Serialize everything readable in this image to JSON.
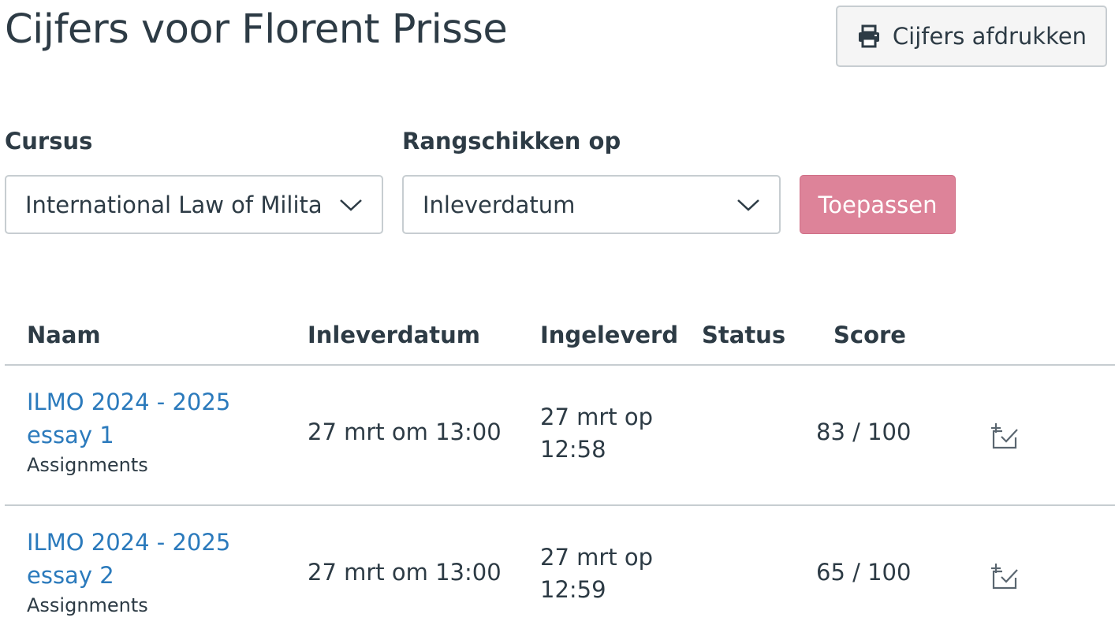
{
  "page": {
    "title": "Cijfers voor Florent Prisse"
  },
  "toolbar": {
    "print_label": "Cijfers afdrukken"
  },
  "filters": {
    "course_label": "Cursus",
    "course_value": "International Law of Militar",
    "sort_label": "Rangschikken op",
    "sort_value": "Inleverdatum",
    "apply_label": "Toepassen"
  },
  "table": {
    "headers": {
      "name": "Naam",
      "due": "Inleverdatum",
      "submitted": "Ingeleverd",
      "status": "Status",
      "score": "Score"
    },
    "rows": [
      {
        "name_line1": "ILMO 2024 - 2025",
        "name_line2": "essay 1",
        "category": "Assignments",
        "due": "27 mrt om 13:00",
        "submitted_line1": "27 mrt op",
        "submitted_line2": "12:58",
        "status": "",
        "score": "83 / 100",
        "icon": "rubric-icon"
      },
      {
        "name_line1": "ILMO 2024 - 2025",
        "name_line2": "essay 2",
        "category": "Assignments",
        "due": "27 mrt om 13:00",
        "submitted_line1": "27 mrt op",
        "submitted_line2": "12:59",
        "status": "",
        "score": "65 / 100",
        "icon": "rubric-icon"
      }
    ]
  },
  "colors": {
    "link": "#2b7abc",
    "apply_button": "#dd8399",
    "text": "#2d3b45"
  }
}
